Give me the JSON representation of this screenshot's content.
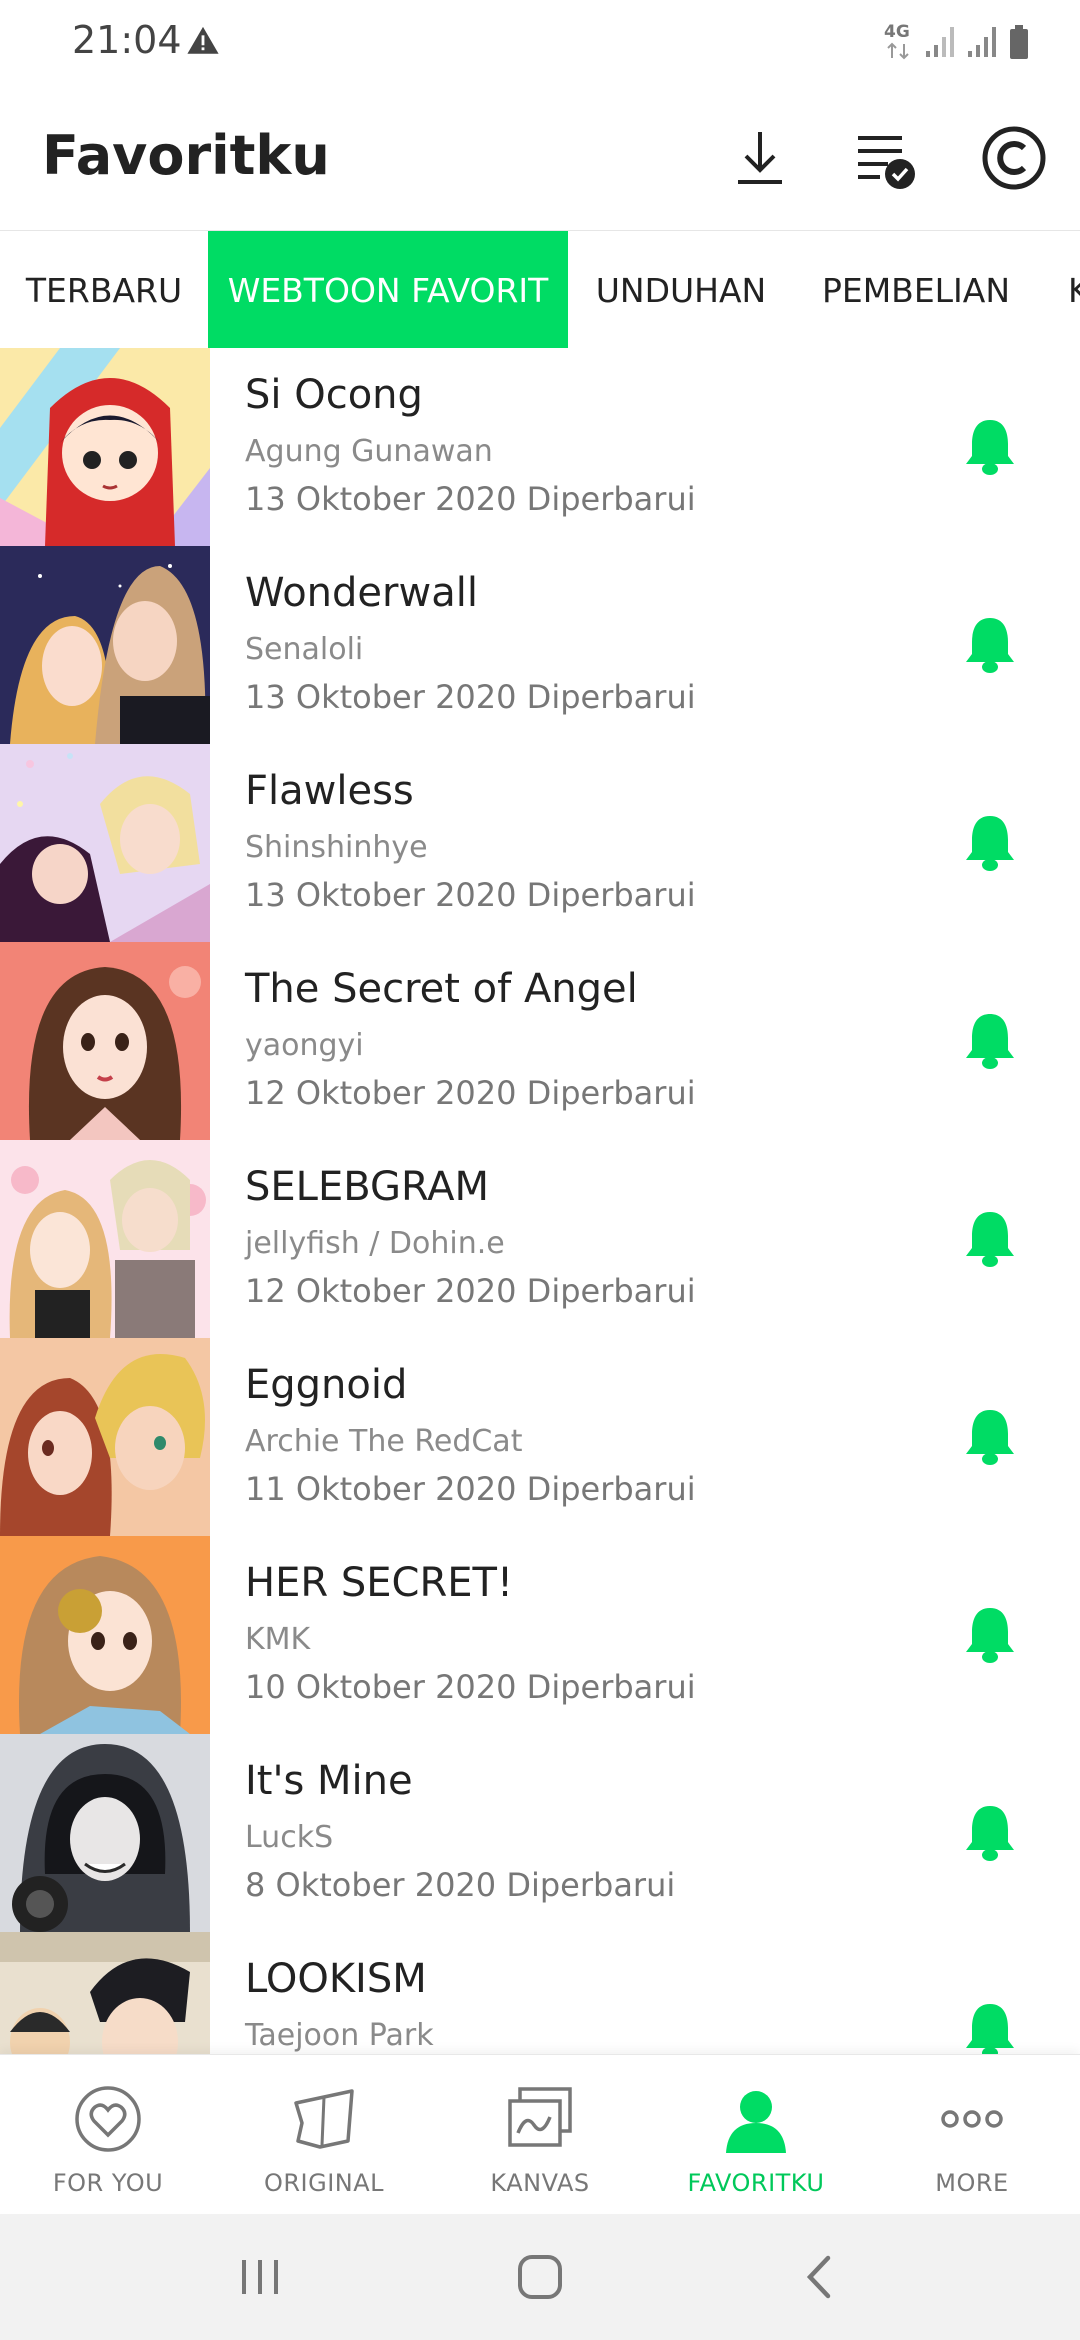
{
  "status_bar": {
    "time": "21:04",
    "network": "4G",
    "icons": [
      "warning-icon",
      "signal-icon",
      "signal-icon",
      "battery-icon"
    ]
  },
  "header": {
    "title": "Favoritku",
    "icons": [
      "download-icon",
      "list-check-icon",
      "copyright-icon"
    ]
  },
  "tabs": [
    {
      "label": "TERBARU"
    },
    {
      "label": "WEBTOON FAVORIT",
      "active": true
    },
    {
      "label": "UNDUHAN"
    },
    {
      "label": "PEMBELIAN"
    },
    {
      "label": "K"
    }
  ],
  "list": [
    {
      "title": "Si Ocong",
      "author": "Agung Gunawan",
      "date": "13 Oktober 2020 Diperbarui"
    },
    {
      "title": "Wonderwall",
      "author": "Senaloli",
      "date": "13 Oktober 2020 Diperbarui"
    },
    {
      "title": "Flawless",
      "author": "Shinshinhye",
      "date": "13 Oktober 2020 Diperbarui"
    },
    {
      "title": "The Secret of Angel",
      "author": "yaongyi",
      "date": "12 Oktober 2020 Diperbarui"
    },
    {
      "title": "SELEBGRAM",
      "author": "jellyfish / Dohin.e",
      "date": "12 Oktober 2020 Diperbarui"
    },
    {
      "title": "Eggnoid",
      "author": "Archie The RedCat",
      "date": "11 Oktober 2020 Diperbarui"
    },
    {
      "title": "HER SECRET!",
      "author": "KMK",
      "date": "10 Oktober 2020 Diperbarui"
    },
    {
      "title": "It's Mine",
      "author": "LuckS",
      "date": "8 Oktober 2020 Diperbarui"
    },
    {
      "title": "LOOKISM",
      "author": "Taejoon Park",
      "date": ""
    }
  ],
  "bottom_nav": [
    {
      "label": "FOR YOU",
      "icon": "heart-circle-icon"
    },
    {
      "label": "ORIGINAL",
      "icon": "book-icon"
    },
    {
      "label": "KANVAS",
      "icon": "canvas-icon"
    },
    {
      "label": "FAVORITKU",
      "icon": "person-icon",
      "active": true
    },
    {
      "label": "MORE",
      "icon": "more-icon"
    }
  ],
  "colors": {
    "accent": "#00dc64",
    "bell": "#00dc64",
    "text": "#222222",
    "muted": "#8a8a8a"
  }
}
